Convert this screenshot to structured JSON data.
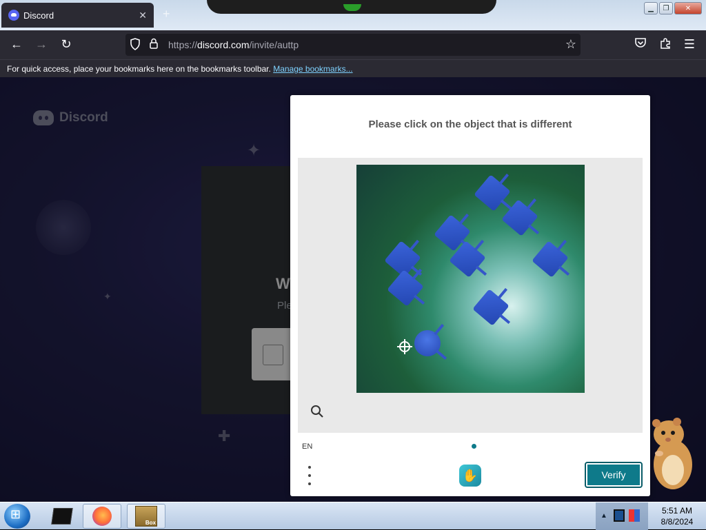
{
  "browser": {
    "tab_title": "Discord",
    "url_prefix": "https://",
    "url_host": "discord.com",
    "url_path": "/invite/auttp",
    "bookmarks_message": "For quick access, place your bookmarks here on the bookmarks toolbar.",
    "manage_bookmarks": "Manage bookmarks..."
  },
  "page": {
    "brand": "Discord",
    "heading_fragment": "W",
    "sub_fragment": "Ple"
  },
  "captcha": {
    "prompt": "Please click on the object that is different",
    "language": "EN",
    "verify_label": "Verify",
    "accent_color": "#0e7a8a"
  },
  "taskbar": {
    "time": "5:51 AM",
    "date": "8/8/2024"
  },
  "icons": [
    "back-icon",
    "forward-icon",
    "reload-icon",
    "shield-icon",
    "lock-icon",
    "star-icon",
    "pocket-icon",
    "extensions-icon",
    "menu-icon",
    "zoom-icon",
    "hcaptcha-logo-icon",
    "kebab-menu-icon"
  ]
}
